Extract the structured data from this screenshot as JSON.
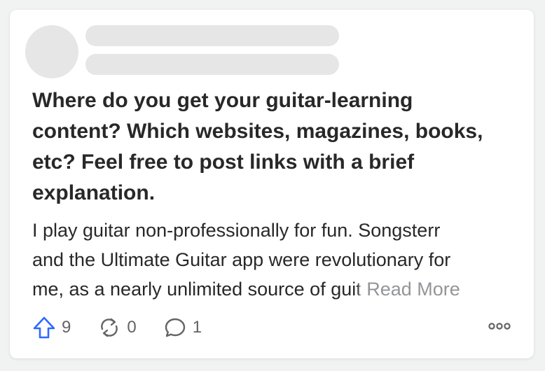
{
  "question": {
    "title": "Where do you get your guitar-learning content? Which websites, magazines, books, etc? Feel free to post links with a brief explanation.",
    "body_line1": "I play guitar non-professionally for fun. Songsterr",
    "body_line2": "and the Ultimate Guitar app were revolutionary for",
    "body_line3_start": "me, as a nearly unlimited source of gu",
    "body_line3_fade": "it",
    "read_more_label": "Read More"
  },
  "actions": {
    "upvotes": "9",
    "shares": "0",
    "comments": "1"
  },
  "colors": {
    "upvote_accent": "#2e69ff",
    "text_primary": "#282829",
    "text_secondary": "#636466",
    "skeleton": "#e6e6e6"
  },
  "icons": {
    "upvote": "upvote-arrow-icon",
    "share": "reshare-icon",
    "comment": "comment-bubble-icon",
    "more": "more-dots-icon"
  }
}
